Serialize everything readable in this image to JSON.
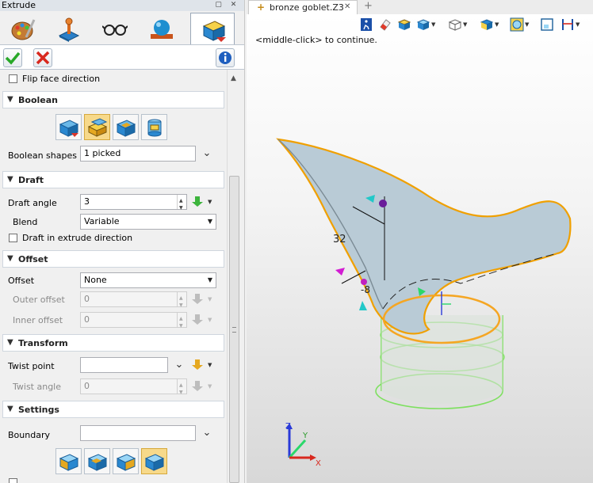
{
  "panel": {
    "title": "Extrude",
    "pin_glyph": "▢",
    "close_glyph": "✕",
    "tabs": [
      {
        "icon": "palette-icon"
      },
      {
        "icon": "joystick-icon"
      },
      {
        "icon": "glasses-icon"
      },
      {
        "icon": "sphere-icon"
      },
      {
        "icon": "cube-active-icon",
        "active": true
      }
    ],
    "actions": {
      "ok_icon": "checkmark-icon",
      "cancel_icon": "x-icon",
      "info_icon": "info-icon"
    },
    "flip_face": {
      "label": "Flip face direction",
      "checked": false
    },
    "boolean": {
      "title": "Boolean",
      "shape_icons": [
        "boolean-base-icon",
        "boolean-add-icon",
        "boolean-remove-icon",
        "boolean-intersect-icon"
      ],
      "selected_index": 1,
      "shapes_label": "Boolean shapes",
      "shapes_value": "1 picked"
    },
    "draft": {
      "title": "Draft",
      "angle_label": "Draft angle",
      "angle_value": "3",
      "blend_label": "Blend",
      "blend_value": "Variable",
      "extrude_dir_label": "Draft in extrude direction"
    },
    "offset": {
      "title": "Offset",
      "offset_label": "Offset",
      "offset_value": "None",
      "outer_label": "Outer offset",
      "outer_value": "0",
      "inner_label": "Inner offset",
      "inner_value": "0"
    },
    "transform": {
      "title": "Transform",
      "twist_point_label": "Twist point",
      "twist_point_value": "",
      "twist_angle_label": "Twist angle",
      "twist_angle_value": "0"
    },
    "settings": {
      "title": "Settings",
      "boundary_label": "Boundary",
      "boundary_value": "",
      "option_icons": [
        "settings-opt-1-icon",
        "settings-opt-2-icon",
        "settings-opt-3-icon",
        "settings-opt-4-icon"
      ],
      "selected_index": 3
    }
  },
  "document": {
    "tab_title": "bronze goblet.Z3",
    "prompt": "<middle-click> to continue.",
    "dimension_label": "32",
    "angle_label": "-8",
    "triad": {
      "x": "X",
      "y": "Y",
      "z": "Z"
    }
  },
  "colors": {
    "accent": "#f5a623",
    "selected_edge": "#f0a000",
    "wire": "#7ee060",
    "surface": "#b9cbd6"
  }
}
